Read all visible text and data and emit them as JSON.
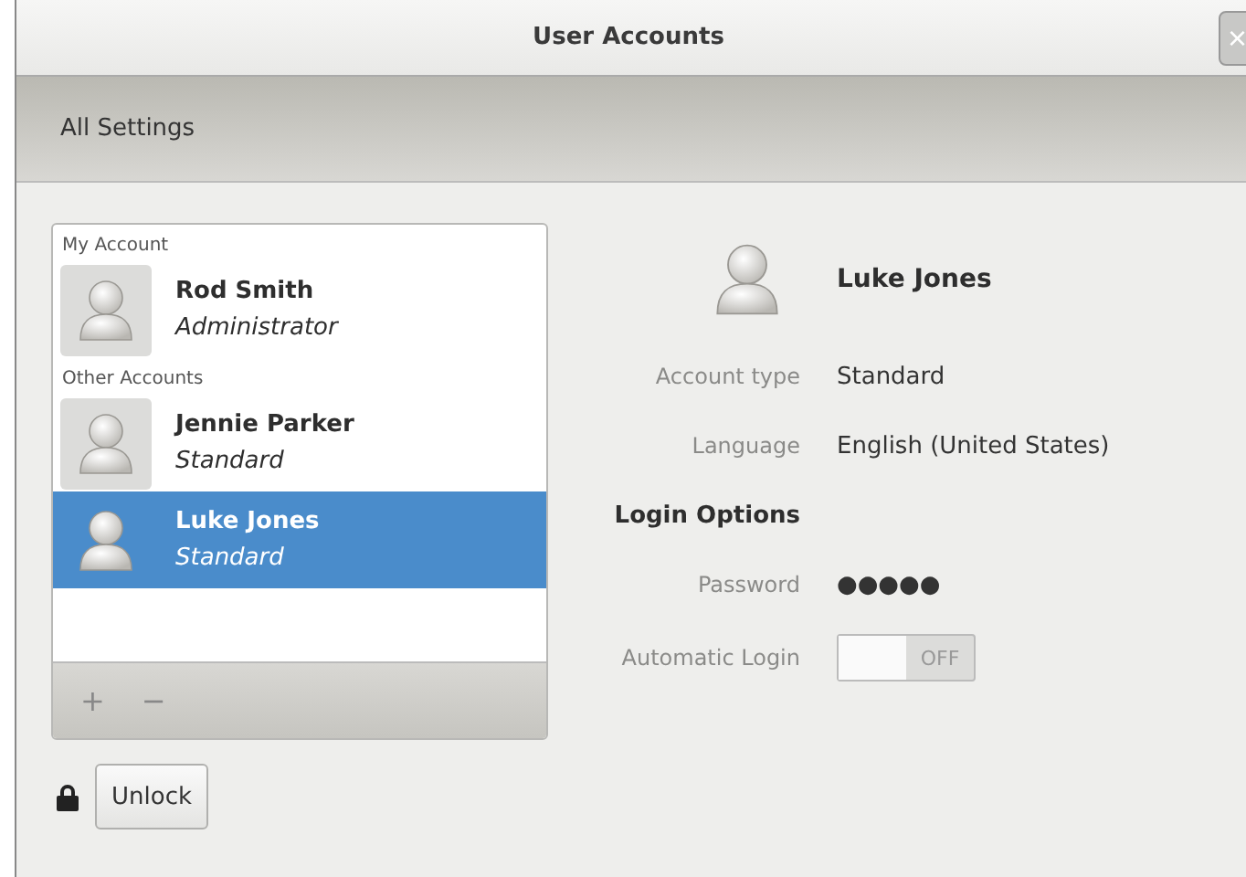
{
  "window": {
    "title": "User Accounts",
    "close": "×"
  },
  "header": {
    "back_label": "All Settings"
  },
  "account_list": {
    "sections": [
      {
        "heading": "My Account",
        "users": [
          {
            "name": "Rod Smith",
            "role": "Administrator",
            "selected": false
          }
        ]
      },
      {
        "heading": "Other Accounts",
        "users": [
          {
            "name": "Jennie Parker",
            "role": "Standard",
            "selected": false
          },
          {
            "name": "Luke Jones",
            "role": "Standard",
            "selected": true
          }
        ]
      }
    ],
    "add": "+",
    "remove": "−"
  },
  "unlock_button": "Unlock",
  "details": {
    "name": "Luke Jones",
    "rows": [
      {
        "kind": "value",
        "label": "Account type",
        "value": "Standard"
      },
      {
        "kind": "value",
        "label": "Language",
        "value": "English (United States)"
      },
      {
        "kind": "heading",
        "label": "Login Options"
      },
      {
        "kind": "value",
        "label": "Password",
        "value": "●●●●●"
      },
      {
        "kind": "toggle",
        "label": "Automatic Login",
        "value": "OFF",
        "on": false
      }
    ]
  }
}
